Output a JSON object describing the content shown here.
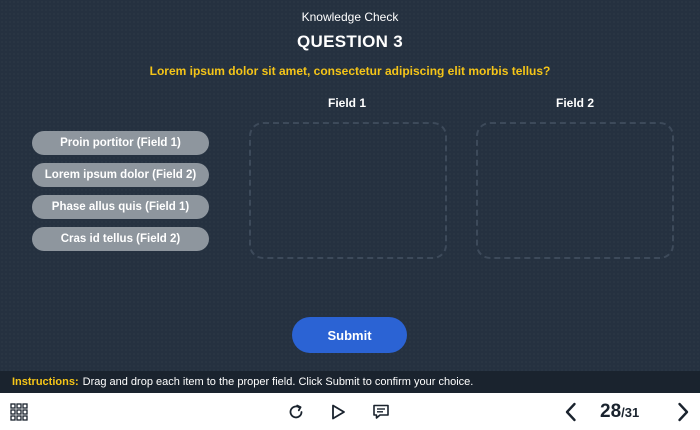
{
  "header": {
    "kicker": "Knowledge Check",
    "title": "QUESTION 3",
    "question": "Lorem ipsum dolor sit amet, consectetur adipiscing elit morbis tellus?"
  },
  "fields": [
    {
      "label": "Field 1"
    },
    {
      "label": "Field 2"
    }
  ],
  "drag_items": [
    {
      "label": "Proin portitor (Field 1)"
    },
    {
      "label": "Lorem ipsum dolor (Field 2)"
    },
    {
      "label": "Phase allus quis (Field 1)"
    },
    {
      "label": "Cras id tellus (Field 2)"
    }
  ],
  "submit_label": "Submit",
  "instructions": {
    "label": "Instructions:",
    "text": "Drag and drop each item to the proper field. Click Submit to confirm your choice."
  },
  "toolbar": {
    "icons": [
      "grid-menu-icon",
      "replay-icon",
      "play-icon",
      "comment-icon",
      "chevron-left-icon",
      "chevron-right-icon"
    ],
    "page_current": "28",
    "page_sep": "/",
    "page_total": "31"
  },
  "colors": {
    "stage_bg": "#253140",
    "accent_yellow": "#f5c518",
    "submit_blue": "#2b63d4",
    "drag_item_bg": "#8e969e",
    "instructions_bg": "#1a232e"
  }
}
